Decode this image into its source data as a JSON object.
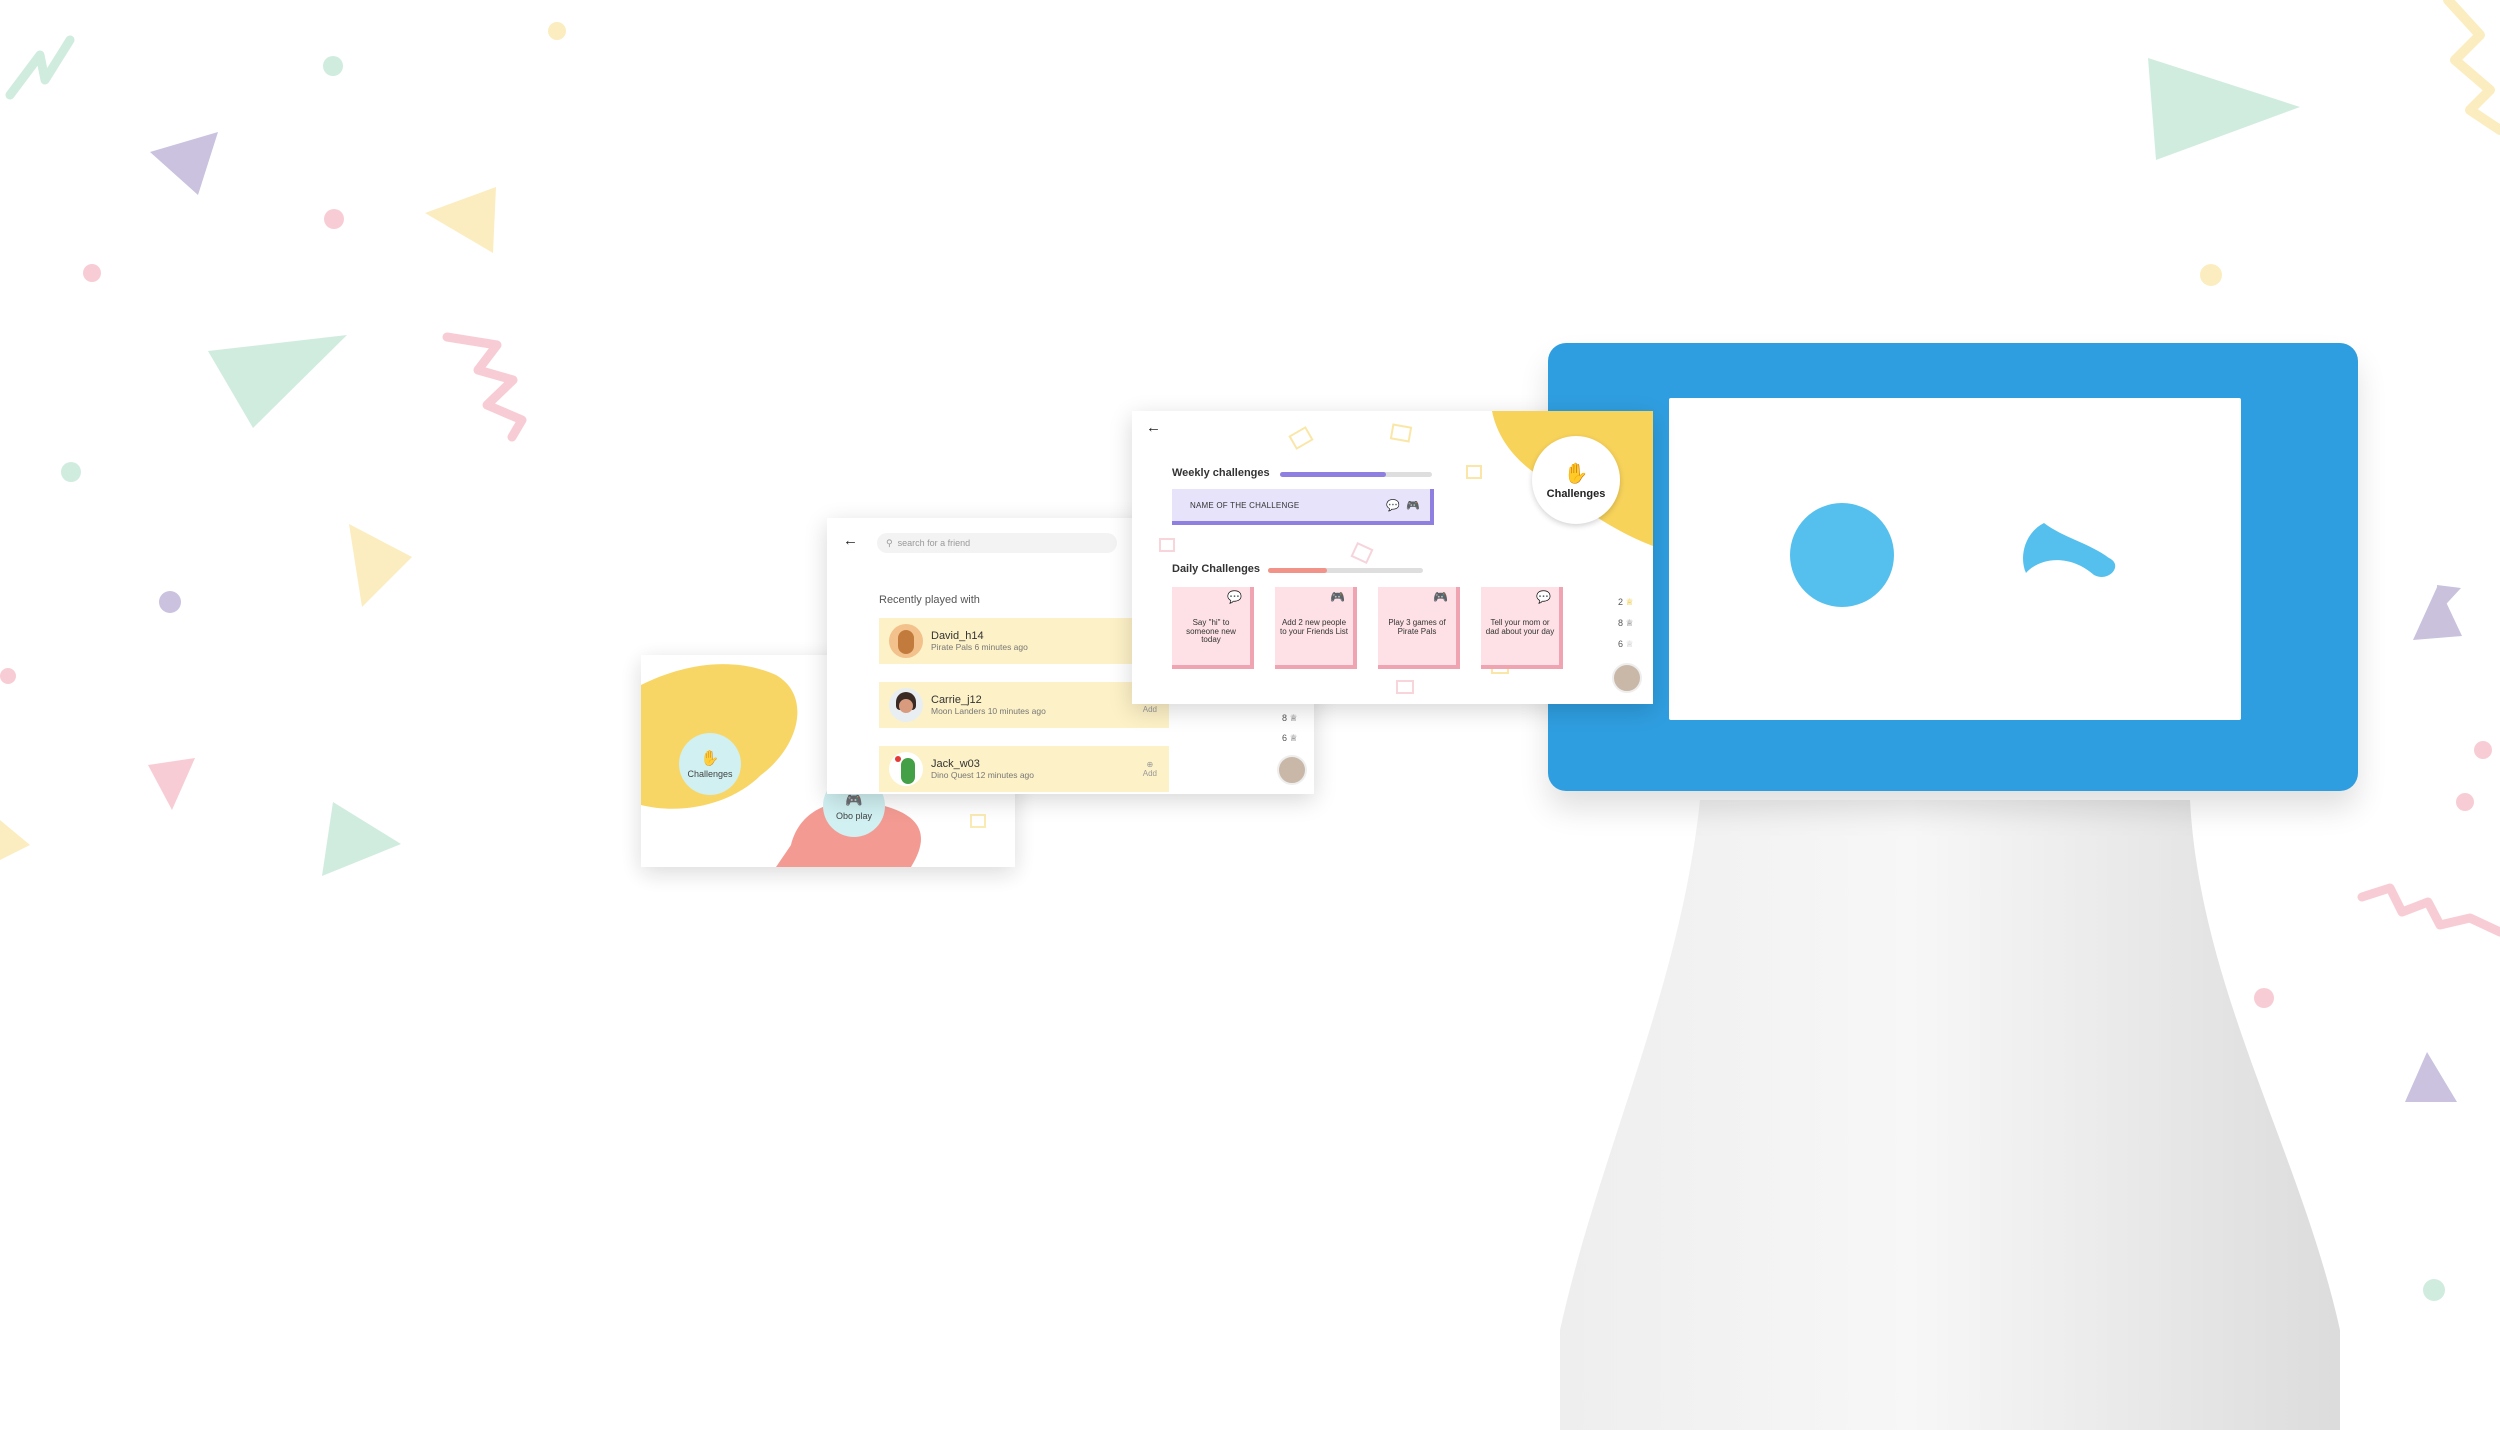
{
  "colors": {
    "robot_blue": "#2f9ee0",
    "eye_blue": "#55c0ee",
    "weekly_purple": "#8f7fe0",
    "daily_pink": "#f0a3b0",
    "friend_row_yellow": "#fdf1c7",
    "blob_yellow": "#f8d35a",
    "blob_coral": "#f2938a"
  },
  "home_screen": {
    "challenges_label": "Challenges",
    "obo_play_label": "Obo play",
    "challenges_icon": "hands-clap-icon",
    "obo_play_icon": "gamepad-icon"
  },
  "friends_screen": {
    "back_icon": "back-arrow-icon",
    "search_placeholder": "search for a friend",
    "section_title": "Recently played with",
    "friends": [
      {
        "name": "David_h14",
        "sub": "Pirate Pals 6 minutes ago",
        "add": ""
      },
      {
        "name": "Carrie_j12",
        "sub": "Moon Landers 10 minutes ago",
        "add": "Add"
      },
      {
        "name": "Jack_w03",
        "sub": "Dino Quest 12 minutes ago",
        "add": "Add"
      }
    ],
    "stats": [
      "8",
      "6"
    ]
  },
  "challenges_screen": {
    "back_icon": "back-arrow-icon",
    "weekly_title": "Weekly challenges",
    "weekly_progress": 0.7,
    "weekly_challenge_name": "NAME OF THE CHALLENGE",
    "daily_title": "Daily Challenges",
    "daily_progress": 0.38,
    "daily": [
      {
        "text": "Say \"hi\" to someone new today",
        "icon": "chat-bubbles-icon"
      },
      {
        "text": "Add 2 new people to your Friends List",
        "icon": "gamepad-icon"
      },
      {
        "text": "Play 3 games of Pirate Pals",
        "icon": "gamepad-icon"
      },
      {
        "text": "Tell your mom or dad about your day",
        "icon": "chat-bubbles-icon"
      }
    ],
    "badge_label": "Challenges",
    "stats": [
      "2",
      "8",
      "6"
    ]
  }
}
